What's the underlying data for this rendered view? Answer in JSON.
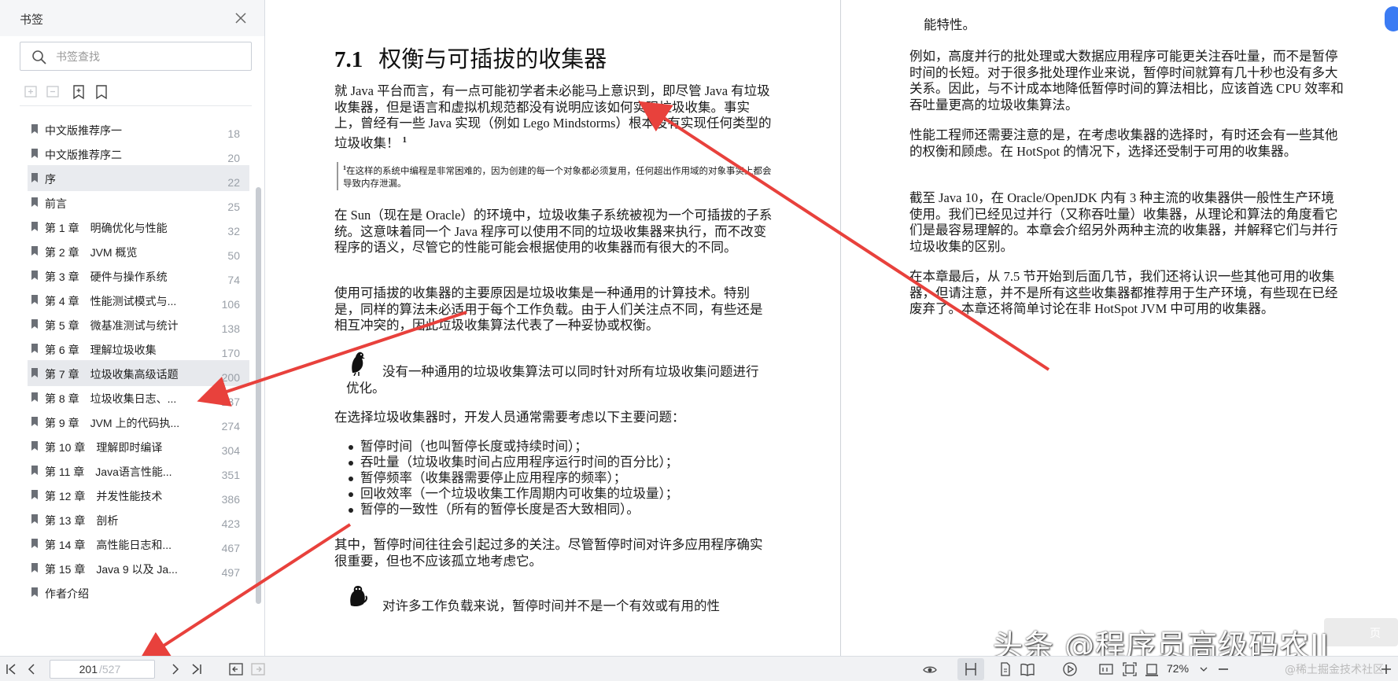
{
  "sidebar": {
    "title": "书签",
    "search_placeholder": "书签查找",
    "items": [
      {
        "label": "中文版推荐序一",
        "page": "18"
      },
      {
        "label": "中文版推荐序二",
        "page": "20"
      },
      {
        "label": "序",
        "page": "22"
      },
      {
        "label": "前言",
        "page": "25"
      },
      {
        "label": "第 1 章　明确优化与性能",
        "page": "32"
      },
      {
        "label": "第 2 章　JVM 概览",
        "page": "50"
      },
      {
        "label": "第 3 章　硬件与操作系统",
        "page": "74"
      },
      {
        "label": "第 4 章　性能测试模式与...",
        "page": "106"
      },
      {
        "label": "第 5 章　微基准测试与统计",
        "page": "138"
      },
      {
        "label": "第 6 章　理解垃圾收集",
        "page": "170"
      },
      {
        "label": "第 7 章　垃圾收集高级话题",
        "page": "200"
      },
      {
        "label": "第 8 章　垃圾收集日志、...",
        "page": "237"
      },
      {
        "label": "第 9 章　JVM 上的代码执...",
        "page": "274"
      },
      {
        "label": "第 10 章　理解即时编译",
        "page": "304"
      },
      {
        "label": "第 11 章　Java语言性能...",
        "page": "351"
      },
      {
        "label": "第 12 章　并发性能技术",
        "page": "386"
      },
      {
        "label": "第 13 章　剖析",
        "page": "423"
      },
      {
        "label": "第 14 章　高性能日志和...",
        "page": "467"
      },
      {
        "label": "第 15 章　Java 9 以及 Ja...",
        "page": "497"
      },
      {
        "label": "作者介绍",
        "page": ""
      }
    ]
  },
  "left_page": {
    "heading_num": "7.1",
    "heading_text": "权衡与可插拔的收集器",
    "p1": "就 Java 平台而言，有一点可能初学者未必能马上意识到，即尽管 Java 有垃圾收集器，但是语言和虚拟机规范都没有说明应该如何实现垃圾收集。事实上，曾经有一些 Java 实现（例如 Lego Mindstorms）根本没有实现任何类型的垃圾收集！",
    "p1_sup": "1",
    "footnote_num": "1",
    "footnote": "在这样的系统中编程是非常困难的，因为创建的每一个对象都必须复用，任何超出作用域的对象事实上都会导致内存泄漏。",
    "p2": "在 Sun（现在是 Oracle）的环境中，垃圾收集子系统被视为一个可插拔的子系统。这意味着同一个 Java 程序可以使用不同的垃圾收集器来执行，而不改变程序的语义，尽管它的性能可能会根据使用的收集器而有很大的不同。",
    "p3": "使用可插拔的收集器的主要原因是垃圾收集是一种通用的计算技术。特别是，同样的算法未必适用于每个工作负载。由于人们关注点不同，有些还是相互冲突的，因此垃圾收集算法代表了一种妥协或权衡。",
    "note1": "没有一种通用的垃圾收集算法可以同时针对所有垃圾收集问题进行优化。",
    "p4": "在选择垃圾收集器时，开发人员通常需要考虑以下主要问题：",
    "bullets": [
      "暂停时间（也叫暂停长度或持续时间）；",
      "吞吐量（垃圾收集时间占应用程序运行时间的百分比）；",
      "暂停频率（收集器需要停止应用程序的频率）；",
      "回收效率（一个垃圾收集工作周期内可收集的垃圾量）；",
      "暂停的一致性（所有的暂停长度是否大致相同）。"
    ],
    "p5": "其中，暂停时间往往会引起过多的关注。尽管暂停时间对许多应用程序确实很重要，但也不应该孤立地考虑它。",
    "note2": "对许多工作负载来说，暂停时间并不是一个有效或有用的性"
  },
  "right_page": {
    "p0": "能特性。",
    "p1": "例如，高度并行的批处理或大数据应用程序可能更关注吞吐量，而不是暂停时间的长短。对于很多批处理作业来说，暂停时间就算有几十秒也没有多大关系。因此，与不计成本地降低暂停时间的算法相比，应该首选 CPU 效率和吞吐量更高的垃圾收集算法。",
    "p2": "性能工程师还需要注意的是，在考虑收集器的选择时，有时还会有一些其他的权衡和顾虑。在 HotSpot 的情况下，选择还受制于可用的收集器。",
    "p3": "截至 Java 10，在 Oracle/OpenJDK 内有 3 种主流的收集器供一般性生产环境使用。我们已经见过并行（又称吞吐量）收集器，从理论和算法的角度看它们是最容易理解的。本章会介绍另外两种主流的收集器，并解释它们与并行垃圾收集的区别。",
    "p4": "在本章最后，从 7.5 节开始到后面几节，我们还将认识一些其他可用的收集器，但请注意，并不是所有这些收集器都推荐用于生产环境，有些现在已经废弃了。本章还将简单讨论在非 HotSpot JVM 中可用的收集器。"
  },
  "bottombar": {
    "current_page": "201",
    "total_pages": "/527",
    "zoom": "72%"
  },
  "watermark": {
    "main": "头条 @程序员高级码农II",
    "sub": "@稀土掘金技术社区",
    "badge": "页"
  },
  "colors": {
    "annotation_arrow": "#e8413c",
    "selected_row": "#e7e9ed",
    "accent": "#3b7bf3"
  }
}
